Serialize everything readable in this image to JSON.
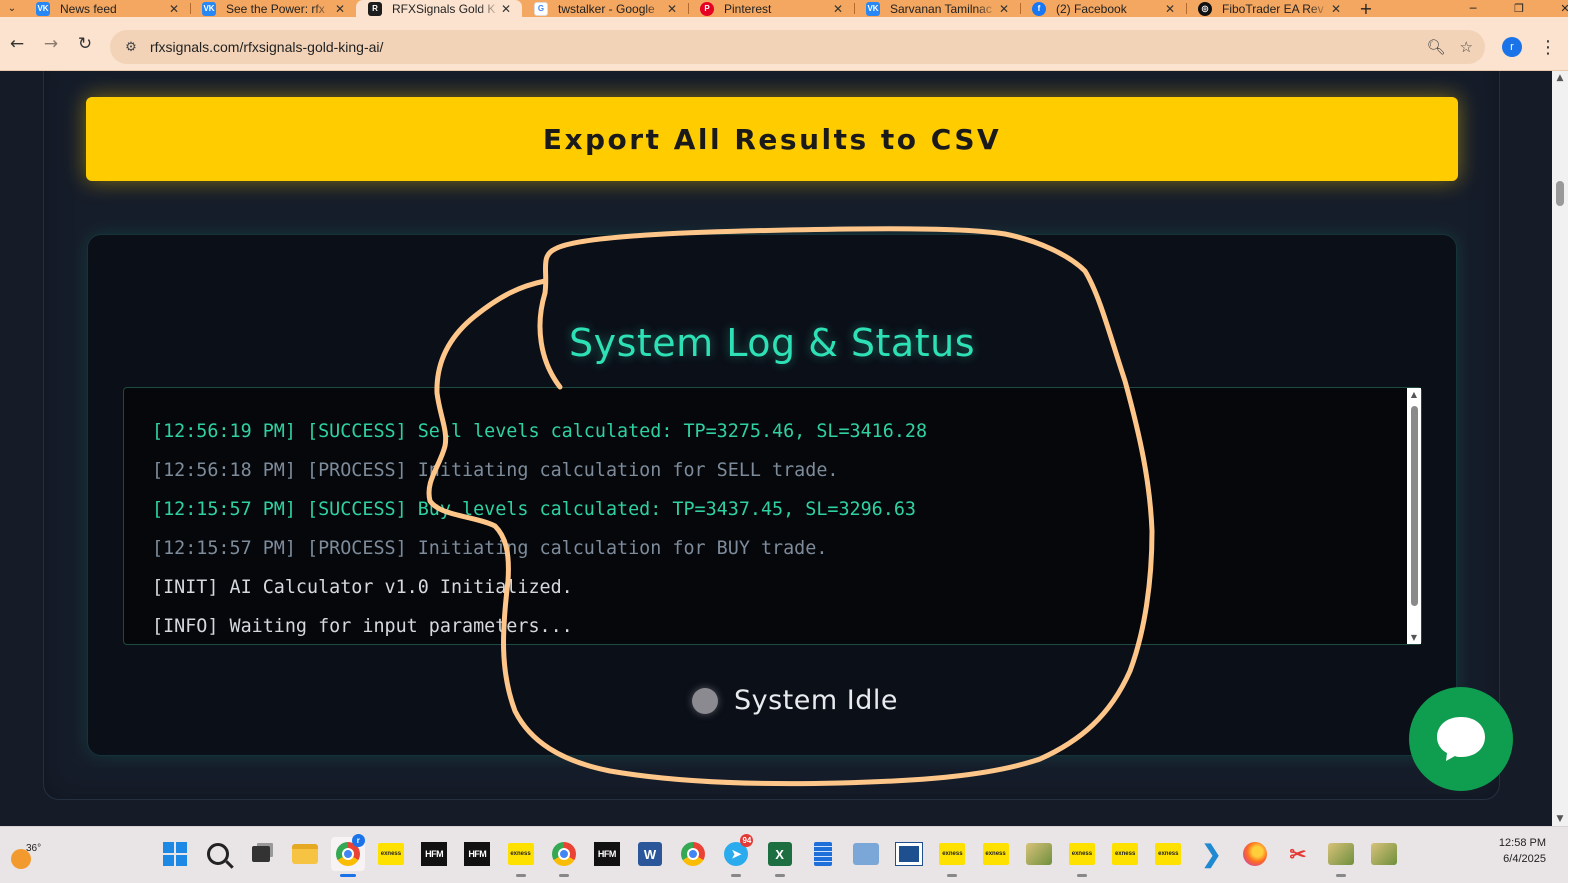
{
  "browser": {
    "tabs": [
      {
        "title": "News feed",
        "favicon": "vk-icon",
        "active": false
      },
      {
        "title": "See the Power: rfx",
        "favicon": "vk-icon",
        "active": false
      },
      {
        "title": "RFXSignals Gold K",
        "favicon": "rfx-icon",
        "active": true
      },
      {
        "title": "twstalker - Google",
        "favicon": "google-icon",
        "active": false
      },
      {
        "title": "Pinterest",
        "favicon": "pinterest-icon",
        "active": false
      },
      {
        "title": "Sarvanan Tamilnac",
        "favicon": "vk-icon",
        "active": false
      },
      {
        "title": "(2) Facebook",
        "favicon": "facebook-icon",
        "active": false
      },
      {
        "title": "FiboTrader EA Rev",
        "favicon": "fibotrader-icon",
        "active": false
      }
    ],
    "url": "rfxsignals.com/rfxsignals-gold-king-ai/",
    "profile_initial": "r",
    "theme_color": "#f4a760"
  },
  "page": {
    "export_button": "Export All Results to CSV",
    "log_title": "System Log & Status",
    "log_lines": [
      {
        "text": "[12:56:19 PM] [SUCCESS] Sell levels calculated: TP=3275.46, SL=3416.28",
        "level": "success"
      },
      {
        "text": "[12:56:18 PM] [PROCESS] Initiating calculation for SELL trade.",
        "level": "process"
      },
      {
        "text": "[12:15:57 PM] [SUCCESS] Buy levels calculated: TP=3437.45, SL=3296.63",
        "level": "success"
      },
      {
        "text": "[12:15:57 PM] [PROCESS] Initiating calculation for BUY trade.",
        "level": "process"
      },
      {
        "text": "[INIT] AI Calculator v1.0 Initialized.",
        "level": "info"
      },
      {
        "text": "[INFO] Waiting for input parameters...",
        "level": "info"
      }
    ],
    "status_text": "System Idle",
    "colors": {
      "accent_yellow": "#ffcc00",
      "accent_teal": "#2ee0b5",
      "annotation": "#ffc68a",
      "chat_green": "#0f9d4f"
    }
  },
  "taskbar": {
    "weather_temp": "36°",
    "telegram_badge": "94",
    "chrome_badge": "r",
    "time": "12:58 PM",
    "date": "6/4/2025",
    "hfm_label": "HFM",
    "exness_label": "exness",
    "word_letter": "W",
    "excel_letter": "X"
  }
}
